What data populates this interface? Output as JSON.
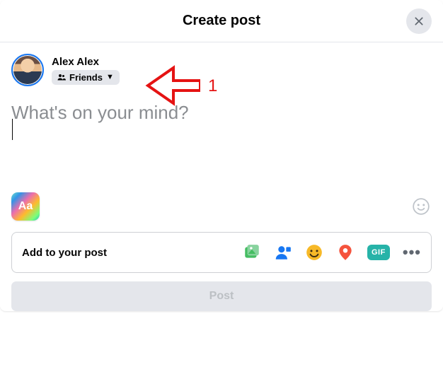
{
  "header": {
    "title": "Create post"
  },
  "user": {
    "name": "Alex Alex",
    "audience_label": "Friends"
  },
  "composer": {
    "placeholder": "What's on your mind?"
  },
  "tools": {
    "aa_label": "Aa"
  },
  "addpost": {
    "label": "Add to your post",
    "gif_label": "GIF"
  },
  "submit": {
    "label": "Post"
  },
  "annotation": {
    "label": "1"
  }
}
